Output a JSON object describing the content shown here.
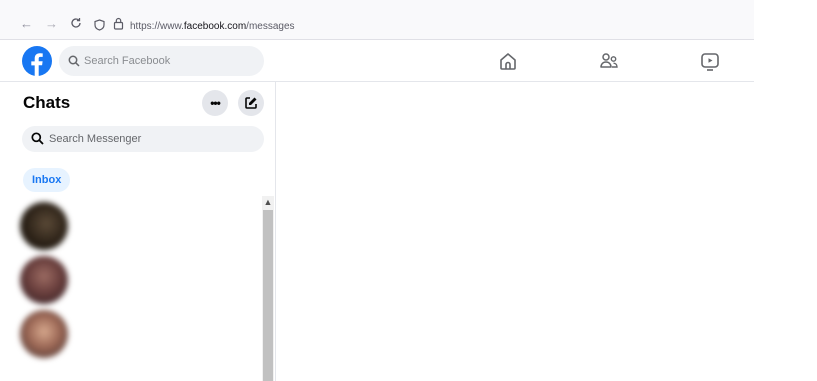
{
  "browser": {
    "back": "←",
    "forward": "→",
    "reload": "C",
    "url_prefix": "https://www.",
    "url_domain": "facebook.com",
    "url_path": "/messages"
  },
  "header": {
    "search_placeholder": "Search Facebook"
  },
  "chats": {
    "title": "Chats",
    "more": "•••",
    "search_placeholder": "Search Messenger",
    "filter": "Inbox"
  },
  "colors": {
    "brand": "#1877f2",
    "pill_bg": "#e7f3ff"
  },
  "icons": [
    "facebook-logo-icon",
    "search-icon",
    "home-icon",
    "friends-icon",
    "watch-icon",
    "compose-icon",
    "shield-icon",
    "lock-icon"
  ]
}
